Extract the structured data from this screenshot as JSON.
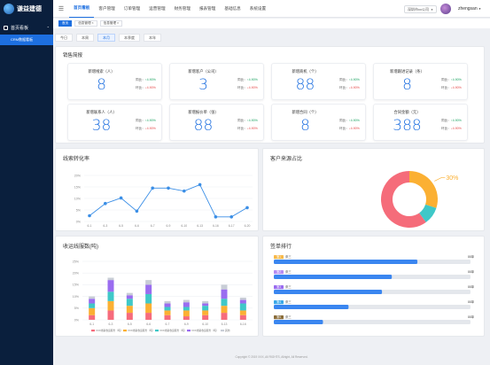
{
  "brand": {
    "logo_text": "谦益建德"
  },
  "sidebar": {
    "group_label": "首页看板",
    "items": [
      {
        "label": "CRM数据看板"
      }
    ]
  },
  "topnav": {
    "items": [
      "首页看板",
      "客户管理",
      "订单管理",
      "运营管理",
      "财务管理",
      "报表管理",
      "基础信息",
      "系统设置"
    ],
    "active_index": 0,
    "company": "深圳市xx公司",
    "username": "zhengsan"
  },
  "tags": [
    {
      "label": "首页",
      "home": true
    },
    {
      "label": "信息管理 ×"
    },
    {
      "label": "信息管理 ×"
    }
  ],
  "periods": [
    "今日",
    "本周",
    "本月",
    "本季度",
    "本年"
  ],
  "active_period": 2,
  "sales": {
    "title": "销售简报",
    "cards": [
      {
        "label": "新增线索（人）",
        "value": "8",
        "cmp1": "同比：",
        "cmp1_val": "↑4.90%",
        "cmp2": "环比：",
        "cmp2_val": "↓4.90%"
      },
      {
        "label": "新增客户（公司）",
        "value": "3",
        "cmp1": "同比：",
        "cmp1_val": "↑4.90%",
        "cmp2": "环比：",
        "cmp2_val": "↓4.90%"
      },
      {
        "label": "新增商机（个）",
        "value": "88",
        "cmp1": "同比：",
        "cmp1_val": "↑4.90%",
        "cmp2": "环比：",
        "cmp2_val": "↓4.90%"
      },
      {
        "label": "新增跟进记录（条）",
        "value": "8",
        "cmp1": "同比：",
        "cmp1_val": "↑4.90%",
        "cmp2": "环比：",
        "cmp2_val": "↓4.90%"
      },
      {
        "label": "新增联系人（人）",
        "value": "38",
        "cmp1": "同比：",
        "cmp1_val": "↑4.90%",
        "cmp2": "环比：",
        "cmp2_val": "↓4.90%"
      },
      {
        "label": "新增报价单（张）",
        "value": "88",
        "cmp1": "同比：",
        "cmp1_val": "↑4.90%",
        "cmp2": "环比：",
        "cmp2_val": "↓4.90%"
      },
      {
        "label": "新增合同（个）",
        "value": "8",
        "cmp1": "同比：",
        "cmp1_val": "↑4.90%",
        "cmp2": "环比：",
        "cmp2_val": "↓4.90%"
      },
      {
        "label": "合同金额（元）",
        "value": "388",
        "cmp1": "同比：",
        "cmp1_val": "↑4.90%",
        "cmp2": "环比：",
        "cmp2_val": "↓4.90%"
      }
    ]
  },
  "colors": {
    "accent": "#1d6fe0",
    "line": "#3a8ee6",
    "bar_series": [
      "#f66b7c",
      "#fbb033",
      "#3fc8c8",
      "#9a6cf0",
      "#c8cdd6"
    ],
    "pie": [
      "#f56c7a",
      "#fbb033",
      "#3fc8c8"
    ],
    "rank_label_colors": [
      "#f8b94a",
      "#b58cf3",
      "#9a6cf0",
      "#3aa8e8",
      "#8a6d3b"
    ]
  },
  "footer": "Copyright © 2019 XXX, All RIGHTS, Allright, All Reserved.",
  "chart_data": [
    {
      "type": "line",
      "title": "线索转化率",
      "x": [
        "6-1",
        "6-3",
        "6-5",
        "6-6",
        "6-7",
        "6-9",
        "6-10",
        "6-13",
        "6-16",
        "6-17",
        "6-20"
      ],
      "values": [
        2.5,
        7.8,
        10.2,
        4.5,
        14.5,
        14.5,
        13.2,
        16.0,
        2.0,
        2.0,
        6.0
      ],
      "yticks": [
        "0%",
        "5%",
        "10%",
        "15%",
        "20%"
      ],
      "ylim": [
        0,
        20
      ]
    },
    {
      "type": "pie",
      "title": "客户来源占比",
      "slices": [
        {
          "value": 60
        },
        {
          "value": 30,
          "label": "30%"
        },
        {
          "value": 10
        }
      ]
    },
    {
      "type": "bar",
      "stacked": true,
      "title": "收运线服数(吨)",
      "categories": [
        "6-1",
        "6-3",
        "6-5",
        "6-6",
        "6-7",
        "6-9",
        "6-10",
        "6-13",
        "6-16"
      ],
      "series": [
        {
          "name": "XXX线路收运服务（吨）",
          "values": [
            2,
            4,
            3,
            3,
            2,
            1.5,
            2,
            3,
            2
          ]
        },
        {
          "name": "XXX线路收运服务（吨）",
          "values": [
            3,
            4,
            3,
            4,
            2,
            2.5,
            2,
            3,
            2
          ]
        },
        {
          "name": "XXX线路收运服务（吨）",
          "values": [
            2,
            4,
            3,
            4,
            1.5,
            1.5,
            2,
            3,
            3
          ]
        },
        {
          "name": "XXX线路收运服务（吨）",
          "values": [
            2,
            5,
            1.5,
            4,
            1.5,
            2,
            1,
            4,
            1.5
          ]
        },
        {
          "name": "其他",
          "values": [
            1,
            1,
            1,
            2,
            1,
            1,
            1,
            2,
            1
          ]
        }
      ],
      "yticks": [
        "0%",
        "5%",
        "10%",
        "15%",
        "20%",
        "25%"
      ],
      "ylim": [
        0,
        25
      ]
    },
    {
      "type": "bar",
      "orientation": "horizontal",
      "title": "签单排行",
      "rows": [
        {
          "label": "第1",
          "name": "张三",
          "value": 73,
          "right": "88单"
        },
        {
          "label": "第2",
          "name": "张三",
          "value": 60,
          "right": "88单"
        },
        {
          "label": "第3",
          "name": "张三",
          "value": 55,
          "right": "88单"
        },
        {
          "label": "第4",
          "name": "张三",
          "value": 38,
          "right": "88单"
        },
        {
          "label": "第5",
          "name": "张三",
          "value": 25,
          "right": "88单"
        }
      ],
      "xlim": [
        0,
        100
      ]
    }
  ]
}
